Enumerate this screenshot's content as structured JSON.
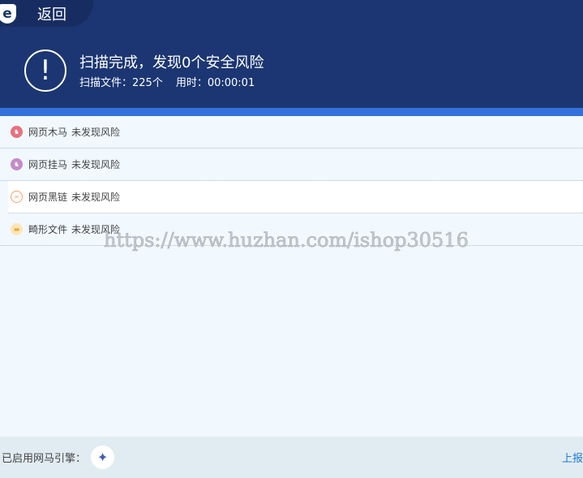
{
  "header": {
    "back_label": "返回",
    "logo_letter": "e",
    "title": "扫描完成，发现0个安全风险",
    "files_scanned": "扫描文件：225个",
    "time_used": "用时：00:00:01"
  },
  "results": [
    {
      "name": "网页木马",
      "status": "未发现风险",
      "icon": "trojan-icon",
      "color": "#e8707f"
    },
    {
      "name": "网页挂马",
      "status": "未发现风险",
      "icon": "hang-horse-icon",
      "color": "#c58ac9"
    },
    {
      "name": "网页黑链",
      "status": "未发现风险",
      "icon": "black-link-icon",
      "color": "#f5a36b"
    },
    {
      "name": "畸形文件",
      "status": "未发现风险",
      "icon": "folder-icon",
      "color": "#f7bd5a"
    }
  ],
  "watermark": "https://www.huzhan.com/ishop30516",
  "footer": {
    "engine_label": "已启用网马引擎：",
    "report_label": "上报"
  }
}
